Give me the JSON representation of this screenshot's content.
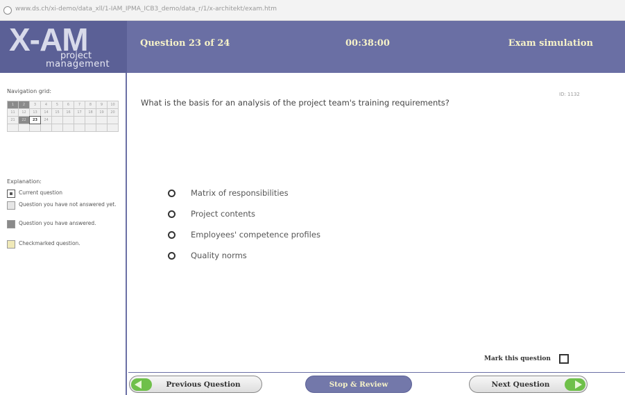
{
  "browser": {
    "url": "www.ds.ch/xi-demo/data_xll/1-IAM_IPMA_ICB3_demo/data_r/1/x-architekt/exam.htm",
    "url_host": "www.ds.ch"
  },
  "header": {
    "logo_main": "X-AM",
    "logo_line1": "project",
    "logo_line2": "management",
    "question_counter": "Question 23 of 24",
    "timer": "00:38:00",
    "mode": "Exam simulation",
    "color": "#6a6fa4"
  },
  "sidebar": {
    "nav_label": "Navigation grid:",
    "grid": {
      "total": 24,
      "answered": [
        1,
        2,
        22
      ],
      "current": 23
    },
    "explanation_label": "Explanation:",
    "legend": [
      {
        "type": "current",
        "label": "Current question"
      },
      {
        "type": "unanswered",
        "label": "Question you have not answered yet."
      },
      {
        "type": "answered",
        "label": "Question you have answered."
      },
      {
        "type": "marked",
        "label": "Checkmarked question."
      }
    ]
  },
  "question": {
    "id": "ID: 1132",
    "text": "What is the basis for an analysis of the project team's training requirements?",
    "options": [
      "Matrix of responsibilities",
      "Project contents",
      "Employees' competence profiles",
      "Quality norms"
    ]
  },
  "mark": {
    "label": "Mark this question",
    "checked": false
  },
  "buttons": {
    "previous": "Previous Question",
    "stop": "Stop & Review",
    "next": "Next Question"
  }
}
